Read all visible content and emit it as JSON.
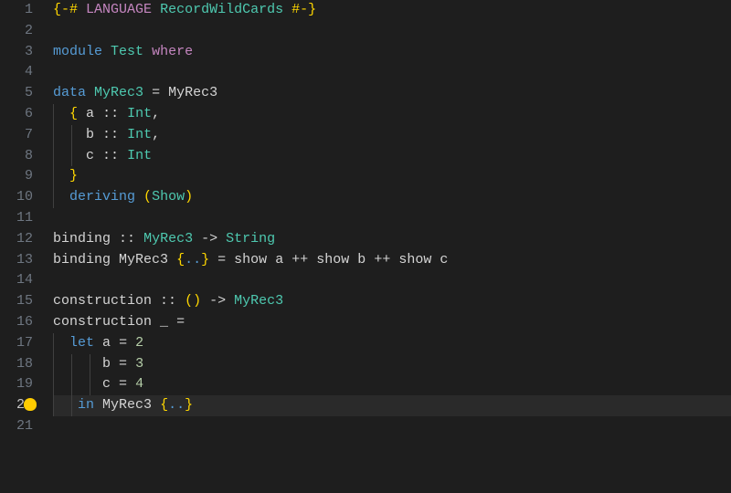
{
  "editor": {
    "currentLine": 20,
    "lines": [
      {
        "n": 1,
        "segments": [
          [
            "{-#",
            "c-pragma-brace"
          ],
          [
            " ",
            ""
          ],
          [
            "LANGUAGE",
            "c-pragma"
          ],
          [
            " ",
            ""
          ],
          [
            "RecordWildCards",
            "c-typename"
          ],
          [
            " ",
            ""
          ],
          [
            "#-}",
            "c-pragma-brace"
          ]
        ]
      },
      {
        "n": 2,
        "segments": []
      },
      {
        "n": 3,
        "segments": [
          [
            "module",
            "c-keyword"
          ],
          [
            " ",
            ""
          ],
          [
            "Test",
            "c-module"
          ],
          [
            " ",
            ""
          ],
          [
            "where",
            "c-where"
          ]
        ]
      },
      {
        "n": 4,
        "segments": []
      },
      {
        "n": 5,
        "segments": [
          [
            "data",
            "c-keyword"
          ],
          [
            " ",
            ""
          ],
          [
            "MyRec3",
            "c-typename"
          ],
          [
            " ",
            ""
          ],
          [
            "=",
            "c-op"
          ],
          [
            " ",
            ""
          ],
          [
            "MyRec3",
            "c-ident"
          ]
        ]
      },
      {
        "n": 6,
        "guides": [
          0
        ],
        "segments": [
          [
            "  ",
            ""
          ],
          [
            "{",
            "c-brace-y"
          ],
          [
            " ",
            ""
          ],
          [
            "a",
            "c-ident"
          ],
          [
            " ",
            ""
          ],
          [
            "::",
            "c-op"
          ],
          [
            " ",
            ""
          ],
          [
            "Int",
            "c-typename"
          ],
          [
            ",",
            "c-punct"
          ]
        ]
      },
      {
        "n": 7,
        "guides": [
          0,
          20
        ],
        "segments": [
          [
            "    ",
            ""
          ],
          [
            "b",
            "c-ident"
          ],
          [
            " ",
            ""
          ],
          [
            "::",
            "c-op"
          ],
          [
            " ",
            ""
          ],
          [
            "Int",
            "c-typename"
          ],
          [
            ",",
            "c-punct"
          ]
        ]
      },
      {
        "n": 8,
        "guides": [
          0,
          20
        ],
        "segments": [
          [
            "    ",
            ""
          ],
          [
            "c",
            "c-ident"
          ],
          [
            " ",
            ""
          ],
          [
            "::",
            "c-op"
          ],
          [
            " ",
            ""
          ],
          [
            "Int",
            "c-typename"
          ]
        ]
      },
      {
        "n": 9,
        "guides": [
          0
        ],
        "segments": [
          [
            "  ",
            ""
          ],
          [
            "}",
            "c-brace-y"
          ]
        ]
      },
      {
        "n": 10,
        "guides": [
          0
        ],
        "segments": [
          [
            "  ",
            ""
          ],
          [
            "deriving",
            "c-keyword"
          ],
          [
            " ",
            ""
          ],
          [
            "(",
            "c-paren-y"
          ],
          [
            "Show",
            "c-typename"
          ],
          [
            ")",
            "c-paren-y"
          ]
        ]
      },
      {
        "n": 11,
        "segments": []
      },
      {
        "n": 12,
        "segments": [
          [
            "binding",
            "c-ident"
          ],
          [
            " ",
            ""
          ],
          [
            "::",
            "c-op"
          ],
          [
            " ",
            ""
          ],
          [
            "MyRec3",
            "c-typename"
          ],
          [
            " ",
            ""
          ],
          [
            "->",
            "c-op"
          ],
          [
            " ",
            ""
          ],
          [
            "String",
            "c-typename"
          ]
        ]
      },
      {
        "n": 13,
        "segments": [
          [
            "binding",
            "c-ident"
          ],
          [
            " ",
            ""
          ],
          [
            "MyRec3",
            "c-ident"
          ],
          [
            " ",
            ""
          ],
          [
            "{",
            "c-brace-y"
          ],
          [
            "..",
            "c-dotdot"
          ],
          [
            "}",
            "c-brace-y"
          ],
          [
            " ",
            ""
          ],
          [
            "=",
            "c-op"
          ],
          [
            " ",
            ""
          ],
          [
            "show",
            "c-ident"
          ],
          [
            " ",
            ""
          ],
          [
            "a",
            "c-ident"
          ],
          [
            " ",
            ""
          ],
          [
            "++",
            "c-op"
          ],
          [
            " ",
            ""
          ],
          [
            "show",
            "c-ident"
          ],
          [
            " ",
            ""
          ],
          [
            "b",
            "c-ident"
          ],
          [
            " ",
            ""
          ],
          [
            "++",
            "c-op"
          ],
          [
            " ",
            ""
          ],
          [
            "show",
            "c-ident"
          ],
          [
            " ",
            ""
          ],
          [
            "c",
            "c-ident"
          ]
        ]
      },
      {
        "n": 14,
        "segments": []
      },
      {
        "n": 15,
        "segments": [
          [
            "construction",
            "c-ident"
          ],
          [
            " ",
            ""
          ],
          [
            "::",
            "c-op"
          ],
          [
            " ",
            ""
          ],
          [
            "(",
            "c-paren-y"
          ],
          [
            ")",
            "c-paren-y"
          ],
          [
            " ",
            ""
          ],
          [
            "->",
            "c-op"
          ],
          [
            " ",
            ""
          ],
          [
            "MyRec3",
            "c-typename"
          ]
        ]
      },
      {
        "n": 16,
        "segments": [
          [
            "construction",
            "c-ident"
          ],
          [
            " ",
            ""
          ],
          [
            "_",
            "c-ident"
          ],
          [
            " ",
            ""
          ],
          [
            "=",
            "c-op"
          ]
        ]
      },
      {
        "n": 17,
        "guides": [
          0
        ],
        "segments": [
          [
            "  ",
            ""
          ],
          [
            "let",
            "c-let"
          ],
          [
            " ",
            ""
          ],
          [
            "a",
            "c-ident"
          ],
          [
            " ",
            ""
          ],
          [
            "=",
            "c-op"
          ],
          [
            " ",
            ""
          ],
          [
            "2",
            "c-num"
          ]
        ]
      },
      {
        "n": 18,
        "guides": [
          0,
          20,
          40
        ],
        "segments": [
          [
            "      ",
            ""
          ],
          [
            "b",
            "c-ident"
          ],
          [
            " ",
            ""
          ],
          [
            "=",
            "c-op"
          ],
          [
            " ",
            ""
          ],
          [
            "3",
            "c-num"
          ]
        ]
      },
      {
        "n": 19,
        "guides": [
          0,
          20,
          40
        ],
        "segments": [
          [
            "      ",
            ""
          ],
          [
            "c",
            "c-ident"
          ],
          [
            " ",
            ""
          ],
          [
            "=",
            "c-op"
          ],
          [
            " ",
            ""
          ],
          [
            "4",
            "c-num"
          ]
        ]
      },
      {
        "n": 20,
        "guides": [
          0,
          20
        ],
        "bulb": true,
        "segments": [
          [
            "   ",
            ""
          ],
          [
            "in",
            "c-in"
          ],
          [
            " ",
            ""
          ],
          [
            "MyRec3",
            "c-ident"
          ],
          [
            " ",
            ""
          ],
          [
            "{",
            "c-brace-y"
          ],
          [
            "..",
            "c-dotdot"
          ],
          [
            "}",
            "c-brace-y"
          ]
        ]
      },
      {
        "n": 21,
        "segments": []
      }
    ]
  }
}
